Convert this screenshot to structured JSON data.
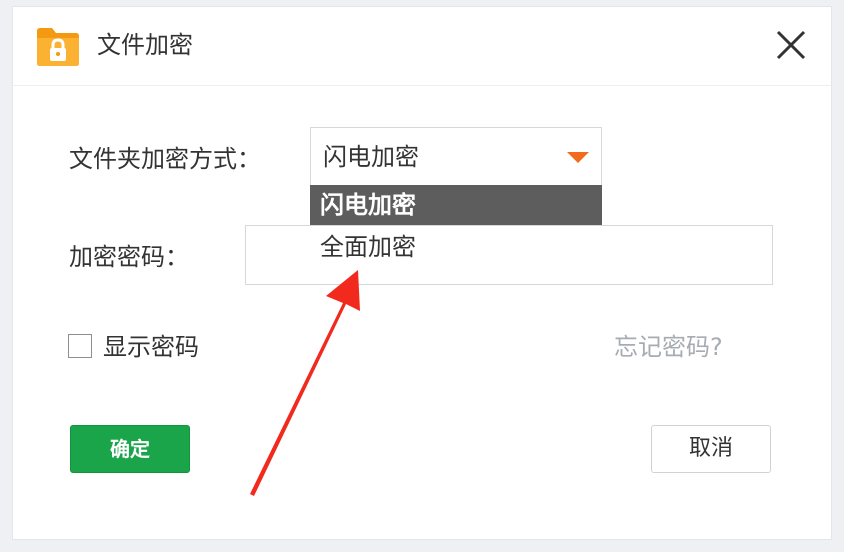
{
  "dialog": {
    "title": "文件加密",
    "icons": {
      "app": "folder-lock-icon",
      "close": "close-icon",
      "dropdown": "caret-down-icon",
      "annotation": "red-arrow-icon"
    }
  },
  "form": {
    "method_label": "文件夹加密方式：",
    "method_selected": "闪电加密",
    "method_options": [
      "闪电加密",
      "全面加密"
    ],
    "password_label": "加密密码：",
    "password_value": "",
    "show_password_label": "显示密码",
    "forgot_password": "忘记密码?"
  },
  "buttons": {
    "ok": "确定",
    "cancel": "取消"
  },
  "colors": {
    "accent_orange": "#f26b1d",
    "ok_green": "#1aa54b",
    "selected_option_bg": "#5d5d5d",
    "annotation_red": "#f2291d",
    "folder_orange": "#f7a11a"
  }
}
